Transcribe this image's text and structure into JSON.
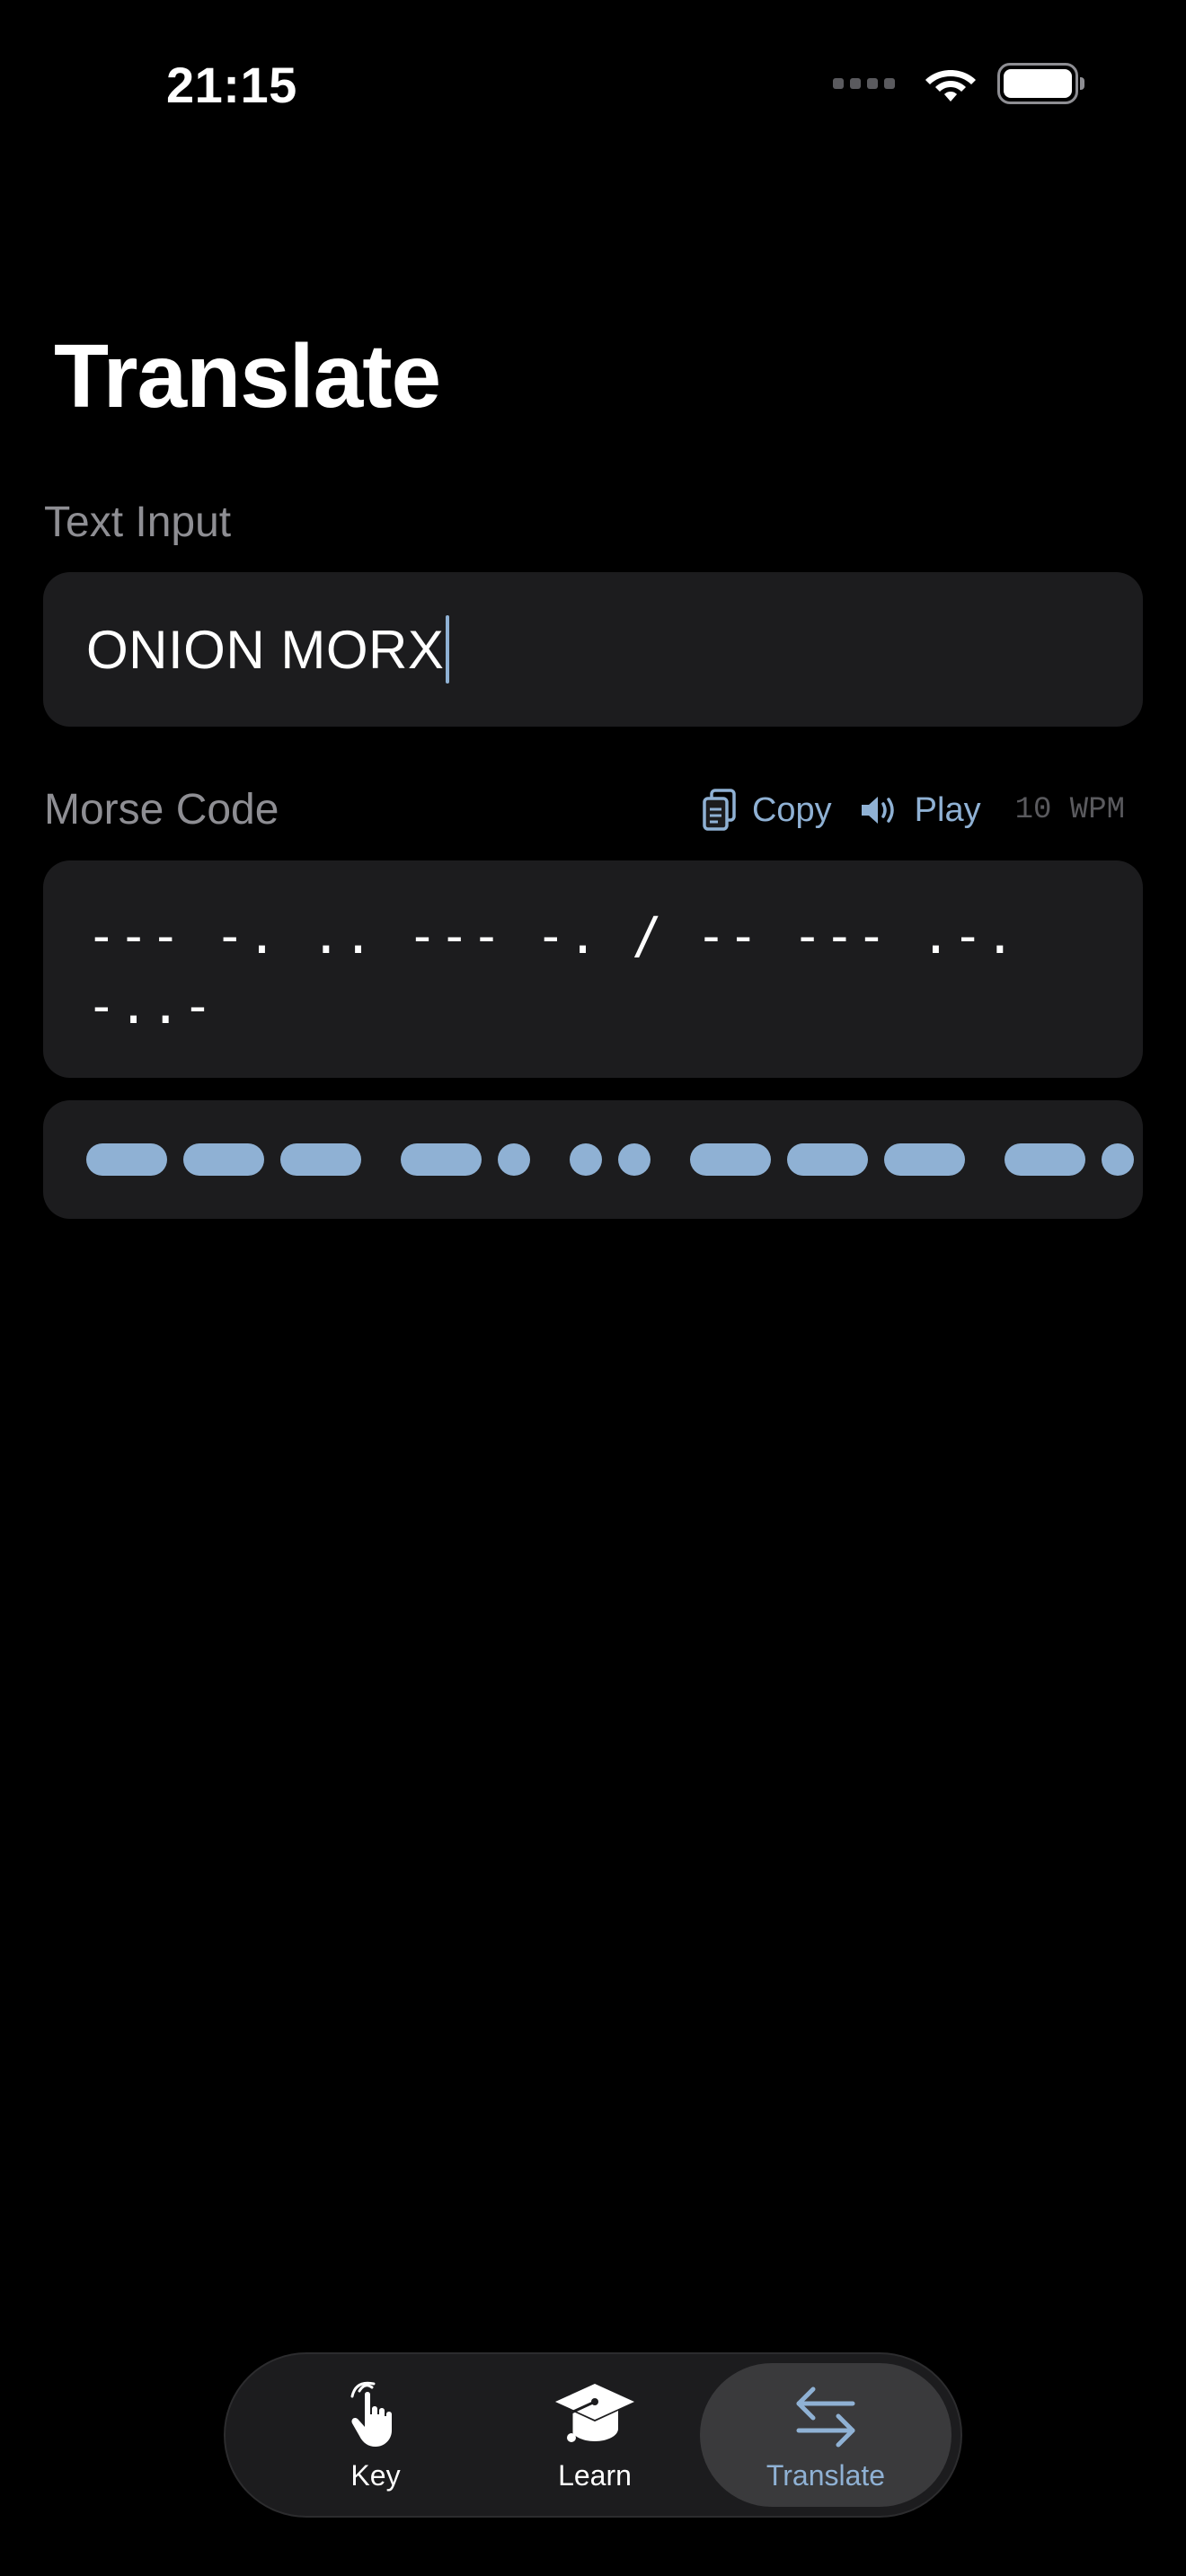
{
  "status_bar": {
    "time": "21:15",
    "signal_icon": "cellular-signal-icon",
    "wifi_icon": "wifi-icon",
    "battery_icon": "battery-icon"
  },
  "page": {
    "title": "Translate"
  },
  "text_input": {
    "label": "Text Input",
    "value": "ONION MORX"
  },
  "morse": {
    "label": "Morse Code",
    "copy_label": "Copy",
    "copy_icon": "copy-icon",
    "play_label": "Play",
    "play_icon": "speaker-icon",
    "wpm": "10 WPM",
    "code": "--- -. .. --- -. / -- --- .-. -..-",
    "visual_color": "#8fb1d4"
  },
  "tabs": {
    "items": [
      {
        "label": "Key",
        "icon": "tap-hand-icon",
        "active": false
      },
      {
        "label": "Learn",
        "icon": "graduation-cap-icon",
        "active": false
      },
      {
        "label": "Translate",
        "icon": "arrows-exchange-icon",
        "active": true
      }
    ]
  },
  "colors": {
    "background": "#000000",
    "card": "#1c1c1e",
    "accent": "#8fb1d4",
    "secondary_text": "#8e8e93"
  }
}
